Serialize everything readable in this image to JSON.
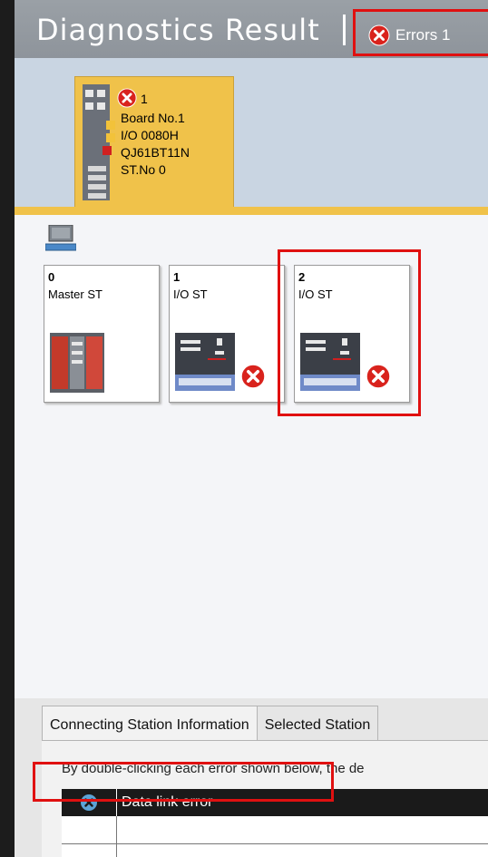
{
  "header": {
    "title": "Diagnostics Result",
    "errors_label": "Errors 1"
  },
  "board": {
    "error_count": "1",
    "board_no": "Board No.1",
    "io": "I/O 0080H",
    "model": "QJ61BT11N",
    "station_no": "ST.No 0"
  },
  "stations": [
    {
      "number": "0",
      "label": "Master ST",
      "has_error": false
    },
    {
      "number": "1",
      "label": "I/O ST",
      "has_error": true
    },
    {
      "number": "2",
      "label": "I/O ST",
      "has_error": true
    }
  ],
  "tabs": [
    "Connecting Station Information",
    "Selected Station"
  ],
  "hint": "By double-clicking each error shown below, the de",
  "errors": [
    {
      "message": "Data link error"
    }
  ],
  "colors": {
    "highlight": "#e01010",
    "board_tab": "#f0c24a",
    "header": "#9aa0a6"
  }
}
